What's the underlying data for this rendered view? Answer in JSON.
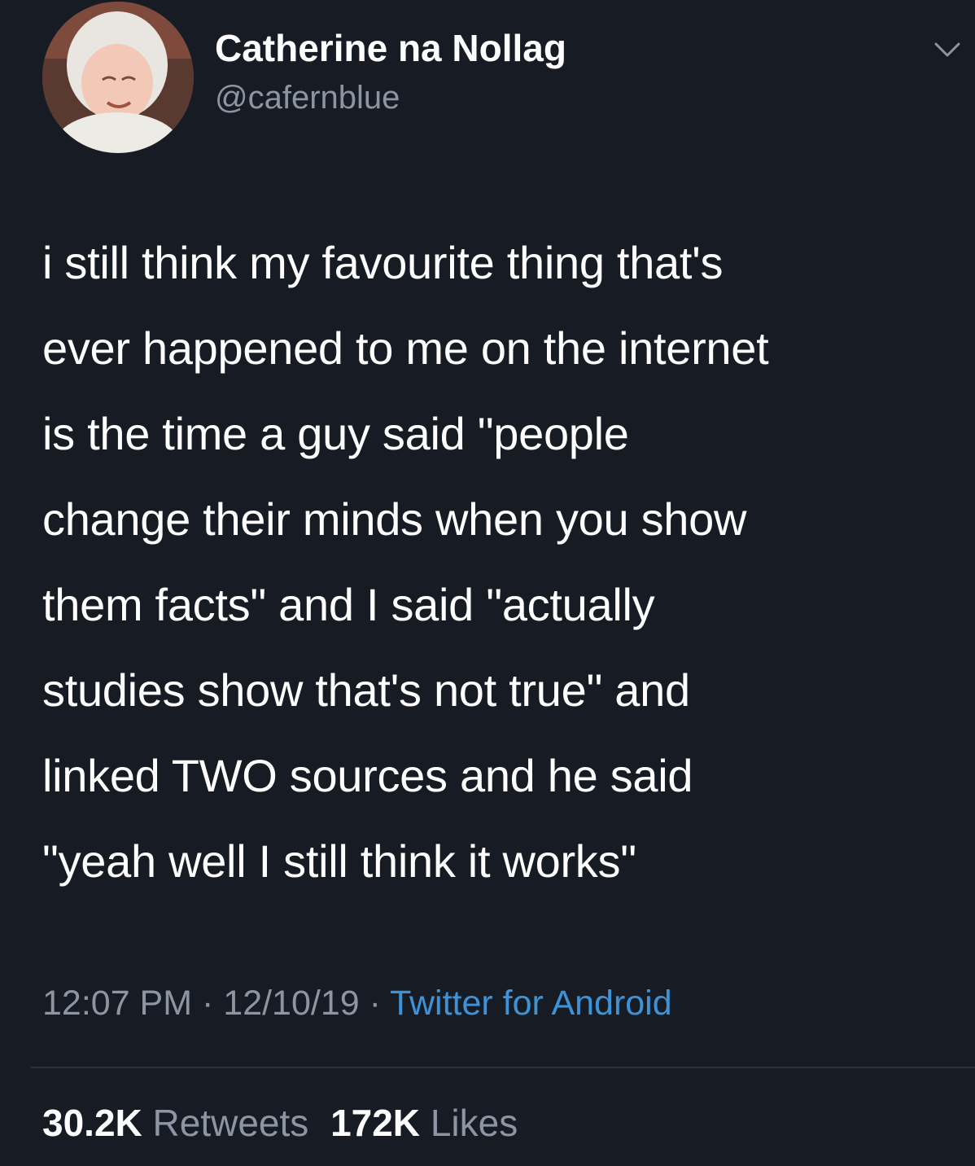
{
  "user": {
    "display_name": "Catherine na Nollag",
    "handle": "@cafernblue",
    "avatar_icon": "avatar-photo"
  },
  "tweet": {
    "lines": [
      "i still think my favourite thing that's",
      "ever happened to me on the internet",
      "is the time a guy said \"people",
      "change their minds when you show",
      "them facts\" and I said \"actually",
      "studies show that's not true\" and",
      "linked TWO sources and he said",
      "\"yeah well I still think it works\""
    ]
  },
  "meta": {
    "time": "12:07 PM",
    "sep1": " · ",
    "date": "12/10/19",
    "sep2": " · ",
    "source": "Twitter for Android"
  },
  "stats": {
    "retweets_count": "30.2K",
    "retweets_label": "Retweets",
    "likes_count": "172K",
    "likes_label": "Likes"
  },
  "colors": {
    "background": "#161b24",
    "text": "#ffffff",
    "muted": "#8c96a3",
    "link": "#3d93d8"
  },
  "icons": {
    "menu": "chevron-down-icon"
  }
}
